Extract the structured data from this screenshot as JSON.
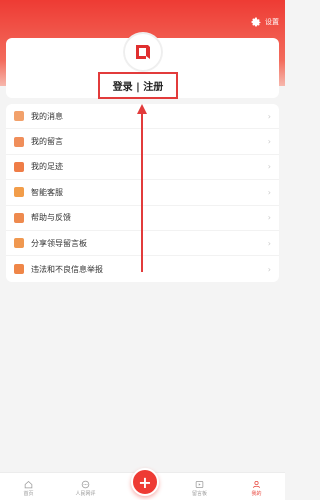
{
  "header": {
    "settings_label": "设置",
    "settings_icon": "gear-icon"
  },
  "profile": {
    "avatar_icon": "app-logo-icon",
    "login_label": "登录 | 注册"
  },
  "menu": {
    "items": [
      {
        "label": "我的消息",
        "icon": "message-icon",
        "color": "#f2a16b"
      },
      {
        "label": "我的留言",
        "icon": "comment-icon",
        "color": "#f08e5a"
      },
      {
        "label": "我的足迹",
        "icon": "footprint-icon",
        "color": "#ef7d47"
      },
      {
        "label": "智能客服",
        "icon": "service-icon",
        "color": "#f29d4a"
      },
      {
        "label": "帮助与反馈",
        "icon": "help-icon",
        "color": "#ee8a4e"
      },
      {
        "label": "分享领导留言板",
        "icon": "share-icon",
        "color": "#f09850"
      },
      {
        "label": "违法和不良信息举报",
        "icon": "report-icon",
        "color": "#ef8648"
      }
    ],
    "chevron": "›"
  },
  "tabbar": {
    "tabs": [
      {
        "label": "首页",
        "icon": "home-icon",
        "active": false
      },
      {
        "label": "人民网评",
        "icon": "chat-icon",
        "active": false
      },
      {
        "label": "留言板",
        "icon": "board-icon",
        "active": false
      },
      {
        "label": "我的",
        "icon": "user-icon",
        "active": true
      }
    ],
    "plus_label": "+"
  },
  "colors": {
    "brand": "#ee3b34",
    "highlight_box": "#e23b3b"
  }
}
